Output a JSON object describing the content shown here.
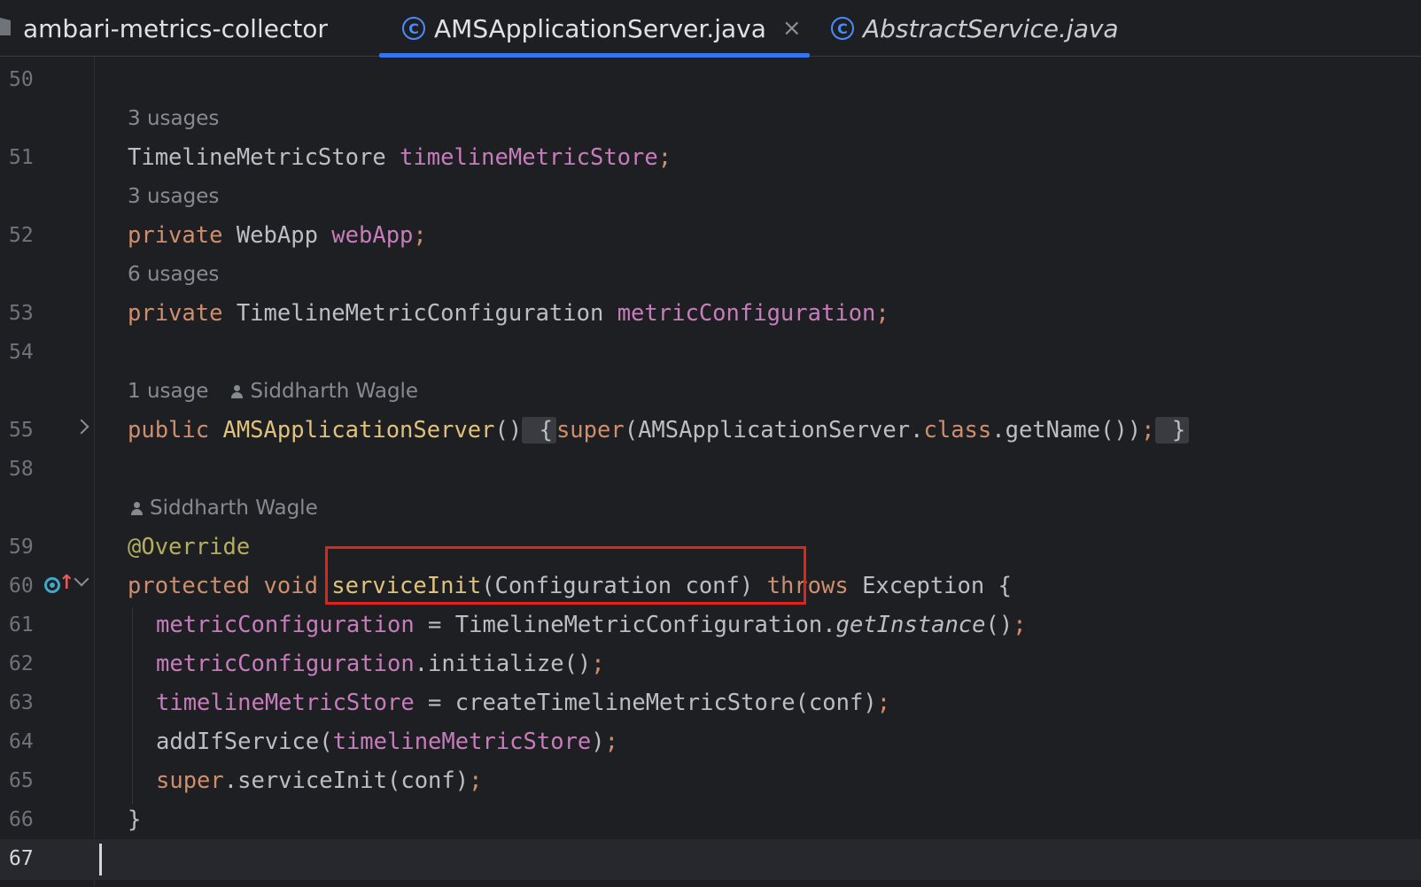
{
  "tabs": {
    "project": "ambari-metrics-collector",
    "active_file": "AMSApplicationServer.java",
    "active_close": "×",
    "other_file": "AbstractService.java",
    "class_icon_glyph": "C"
  },
  "colors": {
    "keyword": "#cf8e6d",
    "field": "#c77dbb",
    "annotation": "#b3ae60",
    "highlight_box": "#e2231a",
    "tab_accent": "#3574f0"
  },
  "editor": {
    "line_numbers": [
      "50",
      "51",
      "52",
      "53",
      "54",
      "55",
      "58",
      "59",
      "60",
      "61",
      "62",
      "63",
      "64",
      "65",
      "66",
      "67"
    ],
    "hints": {
      "usages_51": "3 usages",
      "usages_52": "3 usages",
      "usages_53": "6 usages",
      "usages_55": "1 usage",
      "author": "Siddharth Wagle"
    },
    "code": {
      "l51_type": "TimelineMetricStore ",
      "l51_field": "timelineMetricStore",
      "semi": ";",
      "private": "private ",
      "l52_type": "WebApp ",
      "l52_field": "webApp",
      "l53_type": "TimelineMetricConfiguration ",
      "l53_field": "metricConfiguration",
      "public": "public ",
      "ctor_name": "AMSApplicationServer",
      "parens": "()",
      "brace_open": " {",
      "super": "super",
      "l55_args_a": "(AMSApplicationServer.",
      "class_kw": "class",
      "l55_args_b": ".getName())",
      "brace_close": " }",
      "override": "@Override",
      "protected": "protected ",
      "void": "void ",
      "method_name": "serviceInit",
      "method_params": "(Configuration conf) ",
      "throws": "throws ",
      "exception": "Exception {",
      "l61_field": "metricConfiguration",
      "l61_rest_a": " = TimelineMetricConfiguration.",
      "l61_getinstance": "getInstance",
      "l61_rest_b": "()",
      "l62_field": "metricConfiguration",
      "l62_rest": ".initialize()",
      "l63_field": "timelineMetricStore",
      "l63_rest": " = createTimelineMetricStore(conf)",
      "l64_a": "addIfService(",
      "l64_field": "timelineMetricStore",
      "l64_b": ")",
      "l65_super": "super",
      "l65_rest": ".serviceInit(conf)",
      "l66": "}"
    }
  }
}
